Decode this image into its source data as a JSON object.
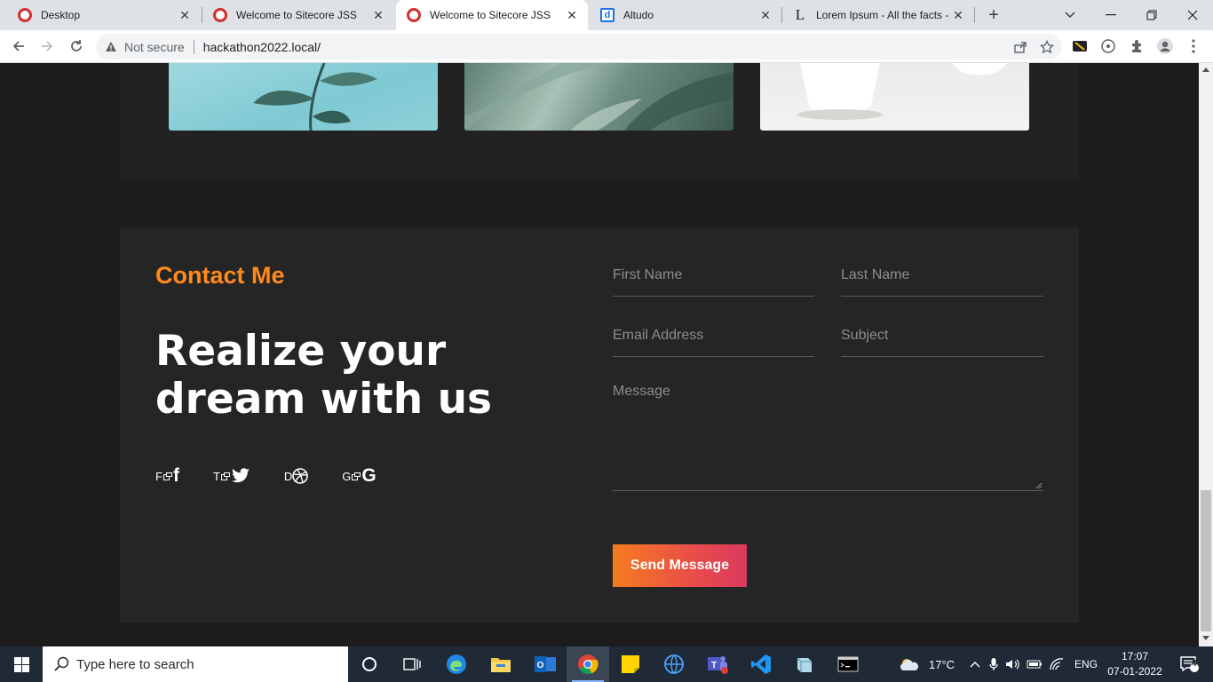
{
  "browser": {
    "tabs": [
      {
        "title": "Desktop",
        "favicon": "opera-icon"
      },
      {
        "title": "Welcome to Sitecore JSS",
        "favicon": "sitecore-icon"
      },
      {
        "title": "Welcome to Sitecore JSS",
        "favicon": "sitecore-icon"
      },
      {
        "title": "Altudo",
        "favicon": "altudo-icon"
      },
      {
        "title": "Lorem Ipsum - All the facts -",
        "favicon": "lipsum-icon"
      }
    ],
    "new_tab": "+",
    "security_label": "Not secure",
    "url": "hackathon2022.local/"
  },
  "contact": {
    "heading": "Contact Me",
    "title": "Realize your dream with us",
    "socials": [
      {
        "label": "F",
        "glyph": "f"
      },
      {
        "label": "T",
        "glyph": "🐦"
      },
      {
        "label": "D",
        "glyph": "⚽"
      },
      {
        "label": "G",
        "glyph": "G"
      }
    ],
    "form": {
      "first_name_placeholder": "First Name",
      "last_name_placeholder": "Last Name",
      "email_placeholder": "Email Address",
      "subject_placeholder": "Subject",
      "message_placeholder": "Message",
      "submit_label": "Send Message"
    }
  },
  "taskbar": {
    "search_placeholder": "Type here to search",
    "weather": "17°C",
    "language": "ENG",
    "time": "17:07",
    "date": "07-01-2022",
    "notification_count": "4"
  },
  "colors": {
    "accent_orange": "#ff8a1a",
    "button_gradient_start": "#f57c1f",
    "button_gradient_end": "#d93a5c",
    "panel_bg": "#252525"
  }
}
